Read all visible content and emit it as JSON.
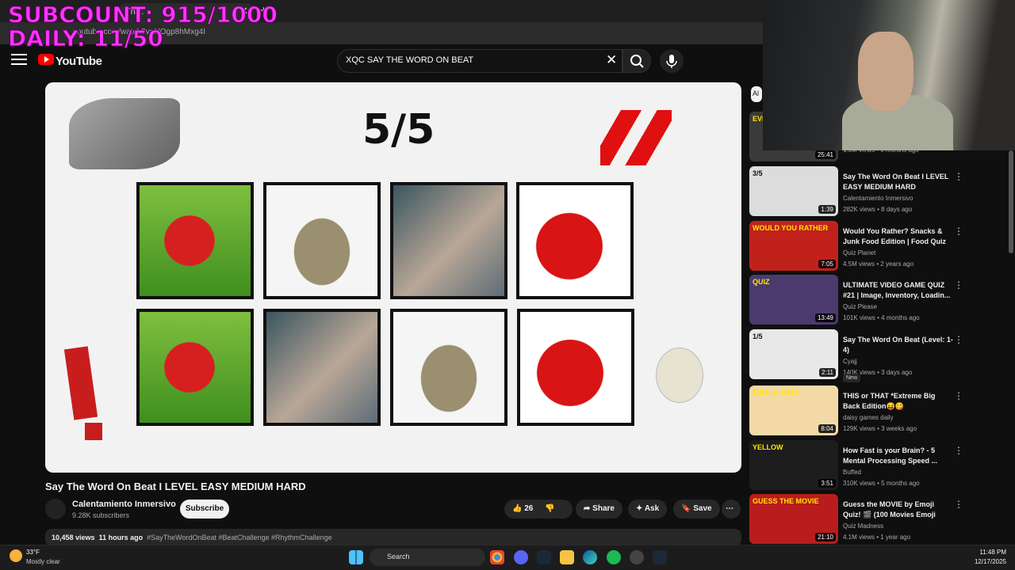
{
  "overlay": {
    "subcount": "SUBCOUNT: 915/1000",
    "daily": "DAILY: 11/50"
  },
  "browser": {
    "tab_title": "Th…",
    "url": "youtube.com/watch?v=HOgp8hMxg4I"
  },
  "header": {
    "brand": "YouTube",
    "search_value": "XQC SAY THE WORD ON BEAT"
  },
  "player": {
    "counter": "5/5"
  },
  "video": {
    "title": "Say The Word On Beat I LEVEL EASY MEDIUM HARD",
    "channel": "Calentamiento Inmersivo",
    "subscribers": "9.28K subscribers",
    "subscribe_label": "Subscribe",
    "likes": "26",
    "share_label": "Share",
    "ask_label": "Ask",
    "save_label": "Save",
    "views": "10,458 views",
    "age": "11 hours ago",
    "tags": "#SayTheWordOnBeat #BeatChallenge #RhythmChallenge"
  },
  "sidebar": {
    "chip": "Al",
    "items": [
      {
        "title": "",
        "channel": "",
        "meta": "1.3M views • 6 months ago",
        "duration": "25:41",
        "thumb_text": "EVERYONE SHOULD I"
      },
      {
        "title": "Say The Word On Beat I LEVEL EASY MEDIUM HARD",
        "channel": "Calentamiento Inmersivo",
        "meta": "282K views • 8 days ago",
        "duration": "1:39",
        "thumb_text": "3/5"
      },
      {
        "title": "Would You Rather? Snacks & Junk Food Edition | Food Quiz",
        "channel": "Quiz Planet",
        "meta": "4.5M views • 2 years ago",
        "duration": "7:05",
        "thumb_text": "WOULD YOU RATHER"
      },
      {
        "title": "ULTIMATE VIDEO GAME QUIZ #21 | Image, Inventory, Loadin...",
        "channel": "Quiz Please",
        "meta": "101K views • 4 months ago",
        "duration": "13:49",
        "thumb_text": "QUIZ"
      },
      {
        "title": "Say The Word On Beat (Level: 1-4)",
        "channel": "Cyajj",
        "meta": "140K views • 3 days ago",
        "duration": "2:11",
        "thumb_text": "1/5",
        "badge": "New"
      },
      {
        "title": "THIS or THAT *Extreme Big Back Edition😝😋",
        "channel": "daisy games daily",
        "meta": "129K views • 3 weeks ago",
        "duration": "8:04",
        "thumb_text": "THIS or THAT"
      },
      {
        "title": "How Fast is your Brain? - 5 Mental Processing Speed ...",
        "channel": "Buffed",
        "meta": "310K views • 5 months ago",
        "duration": "3:51",
        "thumb_text": "YELLOW"
      },
      {
        "title": "Guess the MOVIE by Emoji Quiz! 🎬 (100 Movies Emoji Puzzles...",
        "channel": "Quiz Madness",
        "meta": "4.1M views • 1 year ago",
        "duration": "21:10",
        "thumb_text": "GUESS THE MOVIE"
      }
    ]
  },
  "taskbar": {
    "temperature": "33°F",
    "condition": "Mostly clear",
    "search_label": "Search",
    "time": "11:48 PM",
    "date": "12/17/2025"
  },
  "colors": {
    "accent": "#ff0000",
    "overlay": "#ff33ff",
    "background": "#0f0f0f"
  }
}
